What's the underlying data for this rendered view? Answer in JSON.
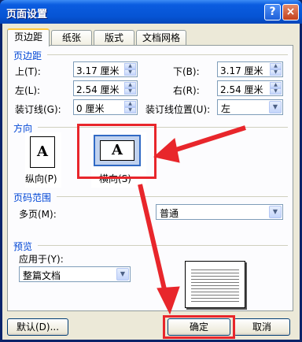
{
  "window": {
    "title": "页面设置",
    "help_button": "?",
    "close_button": "×"
  },
  "tabs": [
    {
      "label": "页边距",
      "active": true
    },
    {
      "label": "纸张",
      "active": false
    },
    {
      "label": "版式",
      "active": false
    },
    {
      "label": "文档网格",
      "active": false
    }
  ],
  "margins": {
    "group_label": "页边距",
    "top": {
      "label": "上(T):",
      "value": "3.17 厘米"
    },
    "bottom": {
      "label": "下(B):",
      "value": "3.17 厘米"
    },
    "left": {
      "label": "左(L):",
      "value": "2.54 厘米"
    },
    "right": {
      "label": "右(R):",
      "value": "2.54 厘米"
    },
    "gutter": {
      "label": "装订线(G):",
      "value": "0 厘米"
    },
    "gutter_position": {
      "label": "装订线位置(U):",
      "value": "左"
    }
  },
  "orientation": {
    "group_label": "方向",
    "portrait": {
      "label": "纵向(P)",
      "glyph": "A"
    },
    "landscape": {
      "label": "横向(S)",
      "glyph": "A",
      "selected": true
    }
  },
  "pages": {
    "group_label": "页码范围",
    "multiple_label": "多页(M):",
    "multiple_value": "普通"
  },
  "preview": {
    "group_label": "预览",
    "apply_to_label": "应用于(Y):",
    "apply_to_value": "整篇文档"
  },
  "buttons": {
    "default": "默认(D)...",
    "ok": "确定",
    "cancel": "取消"
  },
  "annotation_color": "#e8262b"
}
